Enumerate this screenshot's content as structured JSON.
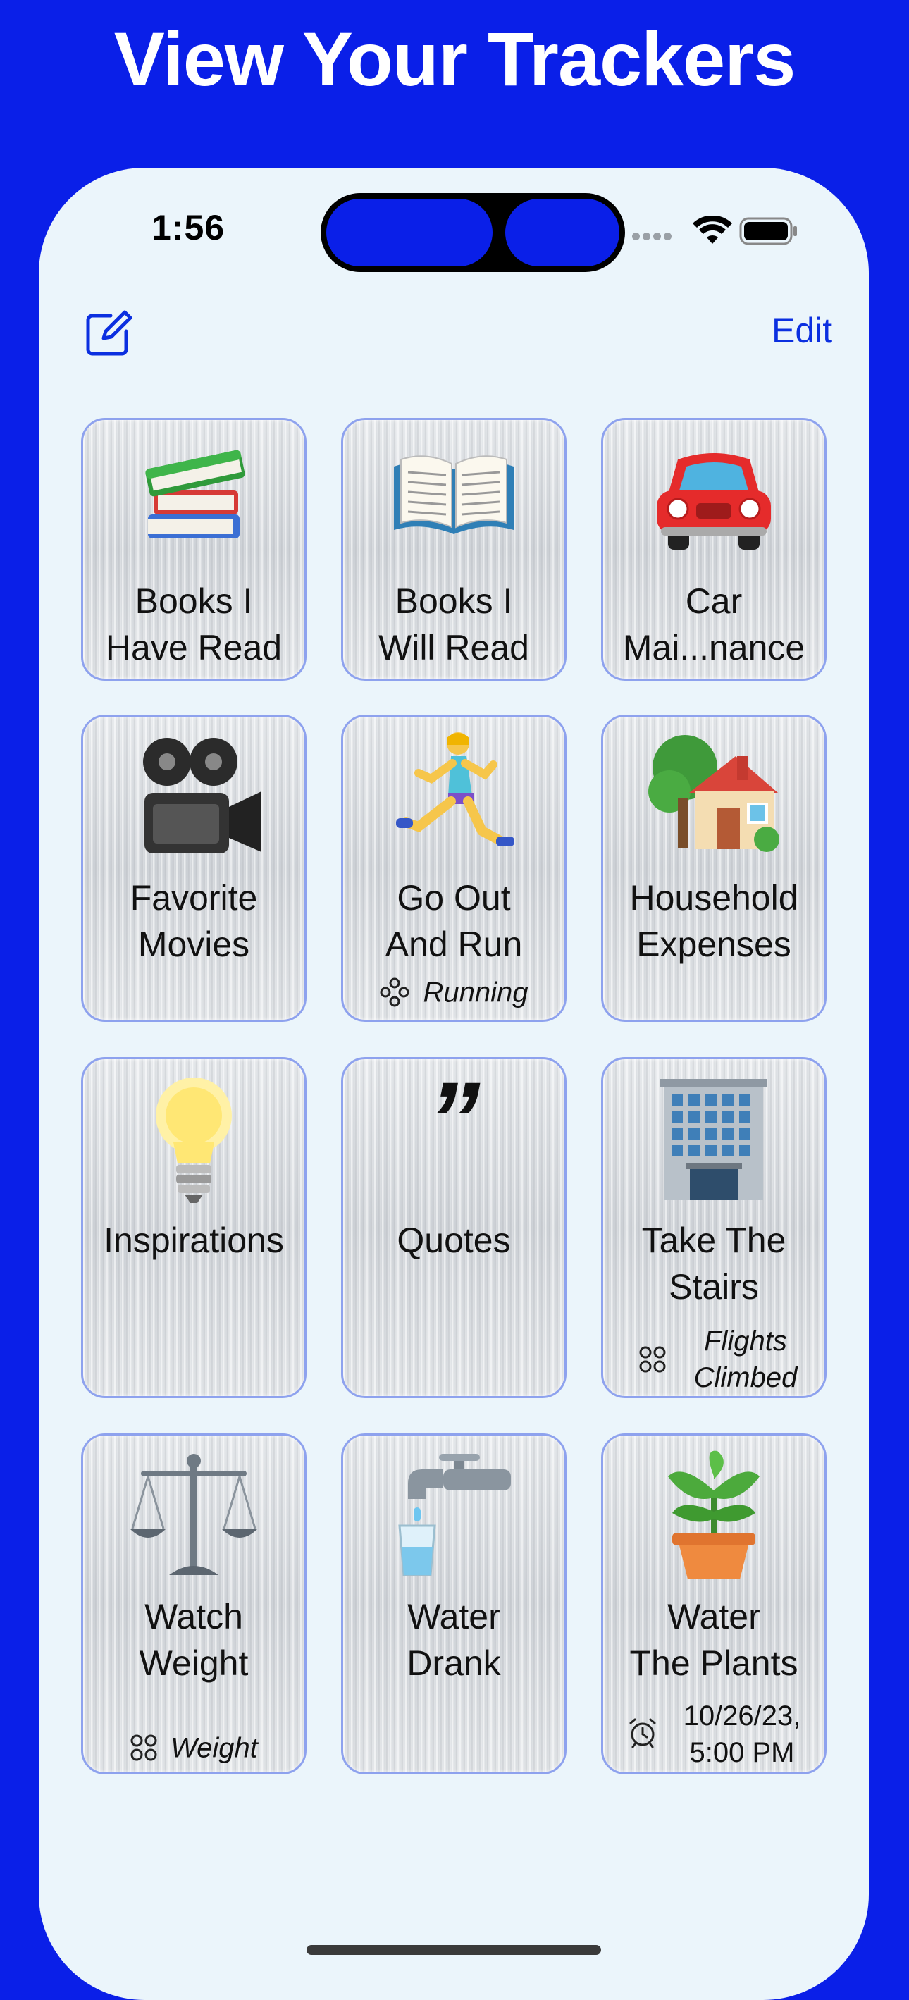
{
  "headline": "View Your Trackers",
  "status_bar": {
    "time": "1:56"
  },
  "nav": {
    "edit_label": "Edit",
    "compose_icon": "compose-icon"
  },
  "colors": {
    "background": "#0a1fe8",
    "accent": "#0b2fe0",
    "tile_border": "#8ea2ee",
    "phone_bg": "#ebf5fb"
  },
  "trackers": [
    {
      "title_line1": "Books I",
      "title_line2": "Have Read",
      "icon": "books-icon"
    },
    {
      "title_line1": "Books I",
      "title_line2": "Will Read",
      "icon": "open-book-icon"
    },
    {
      "title_line1": "Car",
      "title_line2": "Mai...nance",
      "icon": "car-icon"
    },
    {
      "title_line1": "Favorite",
      "title_line2": "Movies",
      "icon": "movie-camera-icon"
    },
    {
      "title_line1": "Go Out",
      "title_line2": "And Run",
      "icon": "runner-icon",
      "meta_icon": "workout-icon",
      "meta": "Running"
    },
    {
      "title_line1": "Household",
      "title_line2": "Expenses",
      "icon": "house-icon"
    },
    {
      "title_line1": "Inspirations",
      "title_line2": "",
      "icon": "lightbulb-icon"
    },
    {
      "title_line1": "Quotes",
      "title_line2": "",
      "icon": "quote-icon",
      "quote_glyph": "”"
    },
    {
      "title_line1": "Take The",
      "title_line2": "Stairs",
      "icon": "office-building-icon",
      "meta_icon": "health-data-icon",
      "meta_line1": "Flights",
      "meta_line2": "Climbed"
    },
    {
      "title_line1": "Watch",
      "title_line2": "Weight",
      "icon": "scales-icon",
      "meta_icon": "health-data-icon",
      "meta": "Weight"
    },
    {
      "title_line1": "Water",
      "title_line2": "Drank",
      "icon": "faucet-icon"
    },
    {
      "title_line1": "Water",
      "title_line2": "The Plants",
      "icon": "potted-plant-icon",
      "meta_icon": "alarm-clock-icon",
      "meta_line1": "10/26/23,",
      "meta_line2": "5:00 PM"
    }
  ]
}
